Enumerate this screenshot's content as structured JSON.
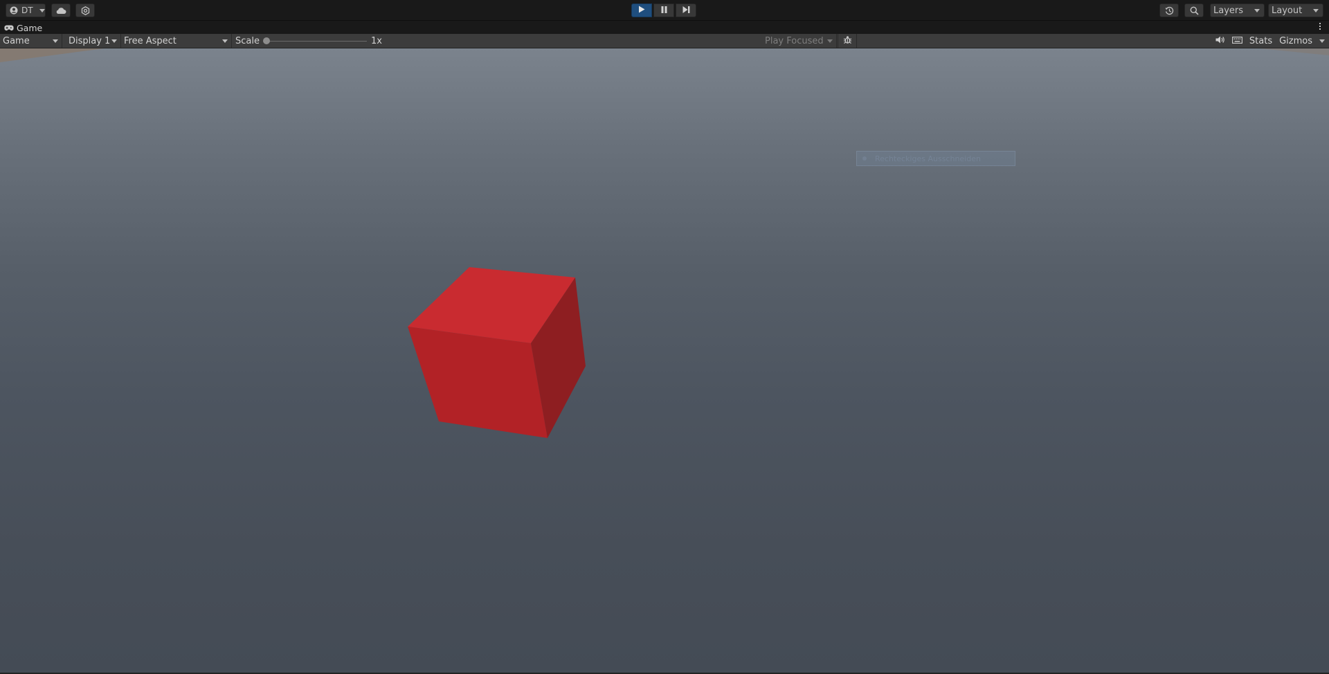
{
  "toolbar": {
    "account_label": "DT",
    "layers_label": "Layers",
    "layout_label": "Layout",
    "play_state": "playing"
  },
  "tab": {
    "title": "Game"
  },
  "game_toolbar": {
    "view_mode": "Game",
    "display": "Display 1",
    "aspect": "Free Aspect",
    "scale_label": "Scale",
    "scale_value": "1x",
    "play_mode": "Play Focused",
    "stats_label": "Stats",
    "gizmos_label": "Gizmos"
  },
  "viewport": {
    "tooltip_text": "Rechteckiges Ausschneiden",
    "cube_color": "#c0262b"
  },
  "colors": {
    "accent_play": "#1f4e7e",
    "toolbar_bg": "#3c3c3c",
    "cube_top": "#c92b30",
    "cube_front": "#b02226",
    "cube_side": "#8f1e21"
  },
  "icons": [
    "account-icon",
    "cloud-icon",
    "collab-icon",
    "play-icon",
    "pause-icon",
    "step-icon",
    "history-icon",
    "search-icon",
    "game-controller-icon",
    "kebab-menu-icon",
    "bug-icon",
    "audio-icon",
    "keyboard-icon"
  ]
}
